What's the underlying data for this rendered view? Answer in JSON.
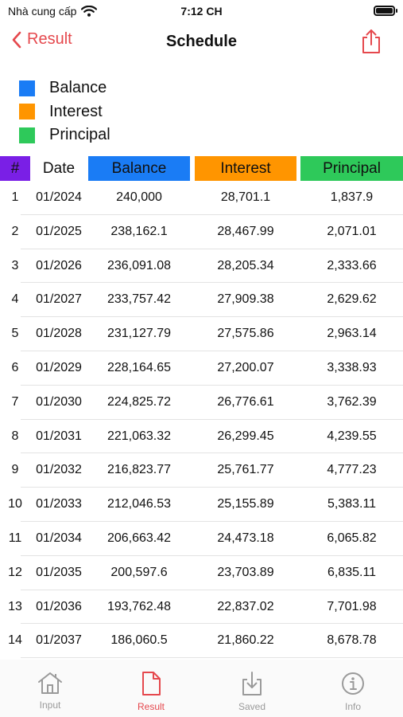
{
  "status_bar": {
    "carrier": "Nhà cung cấp",
    "time": "7:12 CH"
  },
  "nav": {
    "back_label": "Result",
    "title": "Schedule"
  },
  "colors": {
    "accent": "#e5484d",
    "num": "#7a1fe6",
    "balance": "#1a7cf5",
    "interest": "#ff9500",
    "principal": "#2ec95a"
  },
  "legend": [
    {
      "label": "Balance",
      "color": "#1a7cf5"
    },
    {
      "label": "Interest",
      "color": "#ff9500"
    },
    {
      "label": "Principal",
      "color": "#2ec95a"
    }
  ],
  "table": {
    "headers": {
      "num": "#",
      "date": "Date",
      "balance": "Balance",
      "interest": "Interest",
      "principal": "Principal"
    },
    "rows": [
      {
        "num": "1",
        "date": "01/2024",
        "balance": "240,000",
        "interest": "28,701.1",
        "principal": "1,837.9"
      },
      {
        "num": "2",
        "date": "01/2025",
        "balance": "238,162.1",
        "interest": "28,467.99",
        "principal": "2,071.01"
      },
      {
        "num": "3",
        "date": "01/2026",
        "balance": "236,091.08",
        "interest": "28,205.34",
        "principal": "2,333.66"
      },
      {
        "num": "4",
        "date": "01/2027",
        "balance": "233,757.42",
        "interest": "27,909.38",
        "principal": "2,629.62"
      },
      {
        "num": "5",
        "date": "01/2028",
        "balance": "231,127.79",
        "interest": "27,575.86",
        "principal": "2,963.14"
      },
      {
        "num": "6",
        "date": "01/2029",
        "balance": "228,164.65",
        "interest": "27,200.07",
        "principal": "3,338.93"
      },
      {
        "num": "7",
        "date": "01/2030",
        "balance": "224,825.72",
        "interest": "26,776.61",
        "principal": "3,762.39"
      },
      {
        "num": "8",
        "date": "01/2031",
        "balance": "221,063.32",
        "interest": "26,299.45",
        "principal": "4,239.55"
      },
      {
        "num": "9",
        "date": "01/2032",
        "balance": "216,823.77",
        "interest": "25,761.77",
        "principal": "4,777.23"
      },
      {
        "num": "10",
        "date": "01/2033",
        "balance": "212,046.53",
        "interest": "25,155.89",
        "principal": "5,383.11"
      },
      {
        "num": "11",
        "date": "01/2034",
        "balance": "206,663.42",
        "interest": "24,473.18",
        "principal": "6,065.82"
      },
      {
        "num": "12",
        "date": "01/2035",
        "balance": "200,597.6",
        "interest": "23,703.89",
        "principal": "6,835.11"
      },
      {
        "num": "13",
        "date": "01/2036",
        "balance": "193,762.48",
        "interest": "22,837.02",
        "principal": "7,701.98"
      },
      {
        "num": "14",
        "date": "01/2037",
        "balance": "186,060.5",
        "interest": "21,860.22",
        "principal": "8,678.78"
      }
    ]
  },
  "tabbar": {
    "items": [
      {
        "label": "Input",
        "icon": "house-icon",
        "active": false
      },
      {
        "label": "Result",
        "icon": "document-icon",
        "active": true
      },
      {
        "label": "Saved",
        "icon": "download-tray-icon",
        "active": false
      },
      {
        "label": "Info",
        "icon": "info-circle-icon",
        "active": false
      }
    ]
  }
}
